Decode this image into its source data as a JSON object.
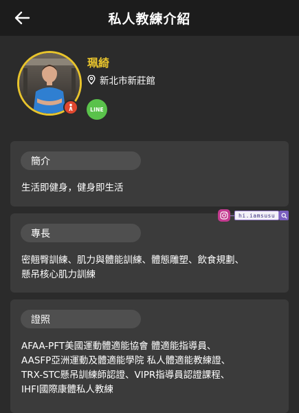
{
  "header": {
    "title": "私人教練介紹",
    "back_icon": "arrow-left-icon"
  },
  "profile": {
    "name": "珮綺",
    "location": "新北市新莊館",
    "location_icon": "map-pin-icon",
    "badge_icon": "coach-badge-icon",
    "line_label": "LINE",
    "accent_color": "#e8c42c",
    "line_color": "#5ac24b"
  },
  "sections": {
    "intro": {
      "label": "簡介",
      "text": "生活即健身，健身即生活"
    },
    "specialty": {
      "label": "專長",
      "lines": [
        "密翹臀訓練、肌力與體能訓練、體態雕塑、飲食規劃、",
        "懸吊核心肌力訓練"
      ]
    },
    "certification": {
      "label": "證照",
      "lines": [
        "AFAA-PFT美國運動體適能協會 體適能指導員、",
        "AASFP亞洲運動及體適能學院 私人體適能教練證、",
        "TRX-STC懸吊訓練師認證、VIPR指導員認證課程、",
        "IHFI國際康體私人教練"
      ]
    }
  },
  "watermark": {
    "text": "hi.iamsusu",
    "icons": [
      "instagram-icon",
      "search-icon"
    ]
  },
  "colors": {
    "background": "#2b2b2b",
    "header": "#1c1c1c",
    "card": "#3b3b3b",
    "pill": "#4f4f4f"
  }
}
